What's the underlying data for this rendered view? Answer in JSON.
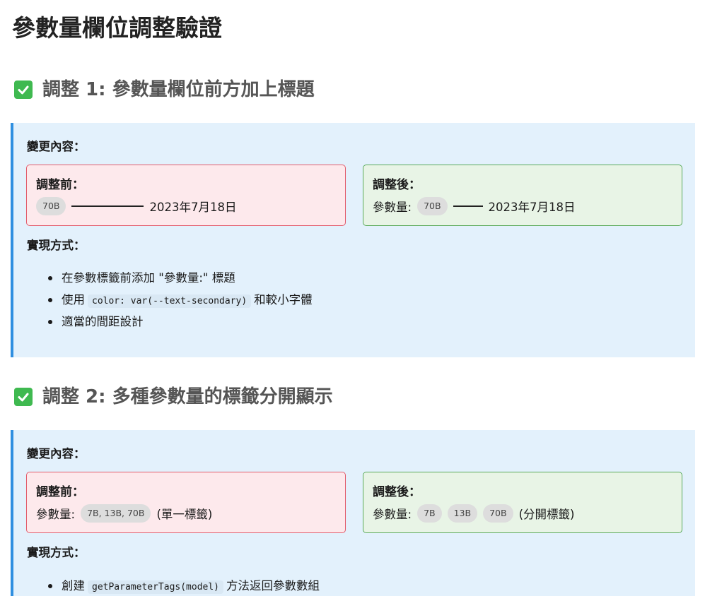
{
  "page_title": "參數量欄位調整驗證",
  "sections": [
    {
      "heading": "調整 1: 參數量欄位前方加上標題",
      "changes_label": "變更內容：",
      "before": {
        "title": "調整前：",
        "tag": "70B",
        "date": "2023年7月18日"
      },
      "after": {
        "title": "調整後：",
        "label": "參數量:",
        "tag": "70B",
        "date": "2023年7月18日"
      },
      "method_label": "實現方式：",
      "methods": [
        {
          "text": "在參數標籤前添加 \"參數量:\" 標題"
        },
        {
          "prefix": "使用",
          "code": "color: var(--text-secondary)",
          "suffix": "和較小字體"
        },
        {
          "text": "適當的間距設計"
        }
      ]
    },
    {
      "heading": "調整 2: 多種參數量的標籤分開顯示",
      "changes_label": "變更內容：",
      "before": {
        "title": "調整前：",
        "label": "參數量:",
        "tag": "7B, 13B, 70B",
        "note": "(單一標籤)"
      },
      "after": {
        "title": "調整後：",
        "label": "參數量:",
        "tags": [
          "7B",
          "13B",
          "70B"
        ],
        "note": "(分開標籤)"
      },
      "method_label": "實現方式：",
      "methods": [
        {
          "prefix": "創建",
          "code": "getParameterTags(model)",
          "suffix": "方法返回參數數組"
        }
      ]
    }
  ],
  "colors": {
    "card_bg": "#e3f1fc",
    "card_border": "#2f8fe0",
    "before_bg": "#fde9ec",
    "before_border": "#e25b6b",
    "after_bg": "#e8f4e6",
    "after_border": "#5aaa5a",
    "check_icon": "#3fb950"
  }
}
